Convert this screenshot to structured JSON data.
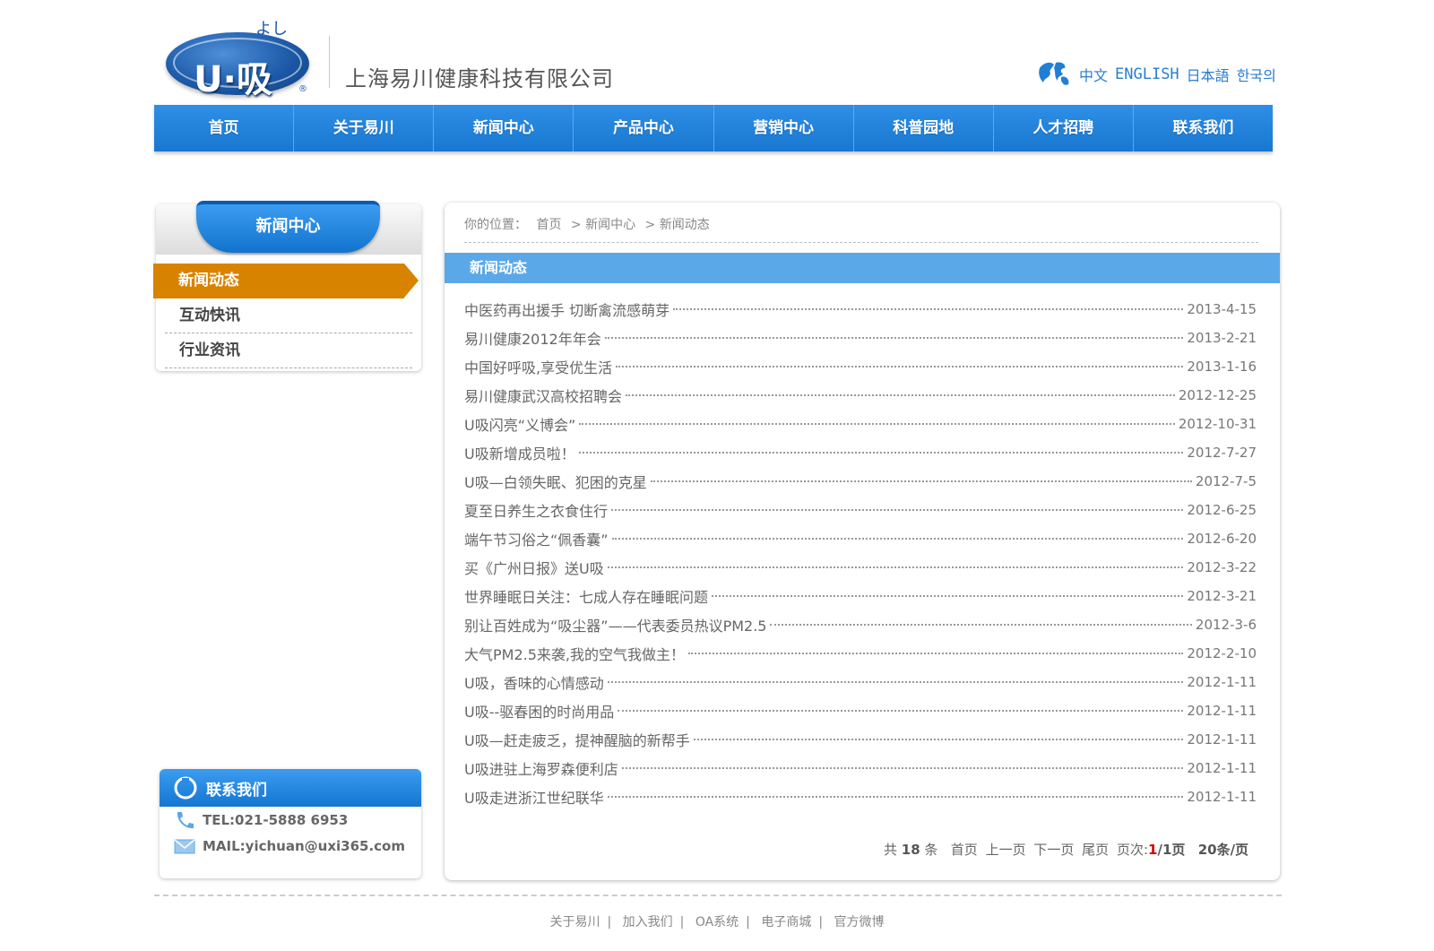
{
  "header": {
    "logo_small": "よし",
    "logo_text": "U·吸",
    "logo_reg": "®",
    "company": "上海易川健康科技有限公司",
    "languages": [
      "中文",
      "ENGLISH",
      "日本語",
      "한국의"
    ]
  },
  "nav": {
    "items": [
      "首页",
      "关于易川",
      "新闻中心",
      "产品中心",
      "营销中心",
      "科普园地",
      "人才招聘",
      "联系我们"
    ]
  },
  "sidebar": {
    "title": "新闻中心",
    "items": [
      {
        "label": "新闻动态",
        "active": true
      },
      {
        "label": "互动快讯",
        "active": false
      },
      {
        "label": "行业资讯",
        "active": false
      }
    ]
  },
  "contact": {
    "title": "联系我们",
    "tel": "TEL:021-5888 6953",
    "mail": "MAIL:yichuan@uxi365.com"
  },
  "breadcrumb": {
    "prefix": "你的位置：",
    "items": [
      "首页",
      "> 新闻中心",
      "> 新闻动态"
    ]
  },
  "section_title": "新闻动态",
  "news": [
    {
      "title": "中医药再出援手 切断禽流感萌芽",
      "date": "2013-4-15"
    },
    {
      "title": "易川健康2012年年会",
      "date": "2013-2-21"
    },
    {
      "title": "中国好呼吸,享受优生活",
      "date": "2013-1-16"
    },
    {
      "title": "易川健康武汉高校招聘会",
      "date": "2012-12-25"
    },
    {
      "title": "U吸闪亮“义博会”",
      "date": "2012-10-31"
    },
    {
      "title": "U吸新增成员啦！",
      "date": "2012-7-27"
    },
    {
      "title": "U吸—白领失眠、犯困的克星",
      "date": "2012-7-5"
    },
    {
      "title": "夏至日养生之衣食住行",
      "date": "2012-6-25"
    },
    {
      "title": "端午节习俗之“佩香囊”",
      "date": "2012-6-20"
    },
    {
      "title": "买《广州日报》送U吸",
      "date": "2012-3-22"
    },
    {
      "title": "世界睡眠日关注：七成人存在睡眠问题",
      "date": "2012-3-21"
    },
    {
      "title": "别让百姓成为“吸尘器”——代表委员热议PM2.5",
      "date": "2012-3-6"
    },
    {
      "title": "大气PM2.5来袭,我的空气我做主！",
      "date": "2012-2-10"
    },
    {
      "title": "U吸，香味的心情感动",
      "date": "2012-1-11"
    },
    {
      "title": "U吸--驱春困的时尚用品",
      "date": "2012-1-11"
    },
    {
      "title": "U吸—赶走疲乏，提神醒脑的新帮手",
      "date": "2012-1-11"
    },
    {
      "title": "U吸进驻上海罗森便利店",
      "date": "2012-1-11"
    },
    {
      "title": "U吸走进浙江世纪联华",
      "date": "2012-1-11"
    }
  ],
  "pager": {
    "total_prefix": "共",
    "total": "18",
    "total_suffix": "条",
    "first": "首页",
    "prev": "上一页",
    "next": "下一页",
    "last": "尾页",
    "page_label": "页次:",
    "current": "1",
    "pages": "/1页",
    "per_page": "20条/页"
  },
  "footer": {
    "links": [
      "关于易川",
      "加入我们",
      "OA系统",
      "电子商城",
      "官方微博"
    ],
    "separator": "|"
  },
  "colors": {
    "nav_blue": "#1f80d8",
    "active_orange": "#d78300",
    "section_blue": "#5ba8e8",
    "pager_red": "#d10000"
  }
}
